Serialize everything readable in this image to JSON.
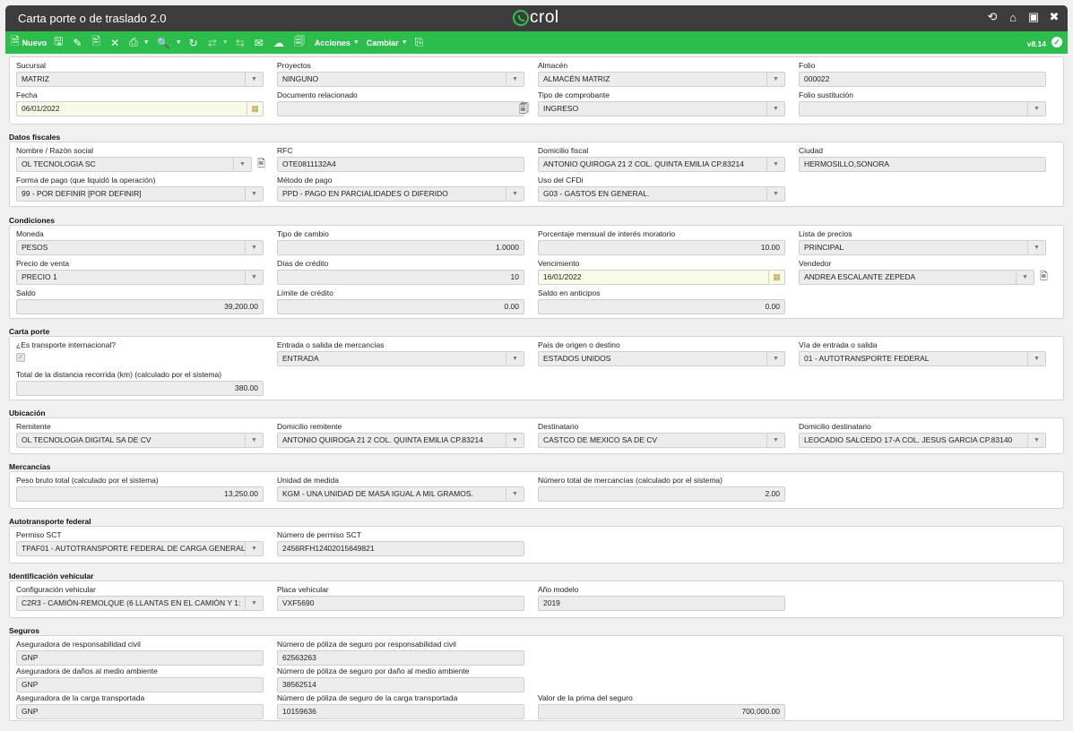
{
  "window": {
    "title": "Carta porte o de traslado 2.0",
    "logo": "crol"
  },
  "window_icons": [
    "refresh-icon",
    "home-icon",
    "window-icon",
    "close-icon"
  ],
  "toolbar": {
    "nuevo": "Nuevo",
    "acciones": "Acciones",
    "cambiar": "Cambiar",
    "version": "v8.14"
  },
  "general": {
    "sucursal": {
      "label": "Sucursal",
      "value": "MATRIZ"
    },
    "proyectos": {
      "label": "Proyectos",
      "value": "NINGUNO"
    },
    "almacen": {
      "label": "Almacén",
      "value": "ALMACÉN MATRIZ"
    },
    "folio": {
      "label": "Folio",
      "value": "000022"
    },
    "fecha": {
      "label": "Fecha",
      "value": "06/01/2022"
    },
    "documento": {
      "label": "Documento relacionado",
      "value": ""
    },
    "tipo": {
      "label": "Tipo de comprobante",
      "value": "INGRESO"
    },
    "folio_sust": {
      "label": "Folio sustitución",
      "value": ""
    }
  },
  "fiscales": {
    "title": "Datos fiscales",
    "nombre": {
      "label": "Nombre / Razón social",
      "value": "OL TECNOLOGIA SC"
    },
    "rfc": {
      "label": "RFC",
      "value": "OTE0811132A4"
    },
    "domicilio": {
      "label": "Domicilio fiscal",
      "value": "ANTONIO QUIROGA 21 2 COL. QUINTA EMILIA CP.83214"
    },
    "ciudad": {
      "label": "Ciudad",
      "value": "HERMOSILLO,SONORA"
    },
    "forma_pago": {
      "label": "Forma de pago (que liquidó la operación)",
      "value": "99 - POR DEFINIR [POR DEFINIR]"
    },
    "metodo_pago": {
      "label": "Método de pago",
      "value": "PPD - PAGO EN PARCIALIDADES O DIFERIDO"
    },
    "uso_cfdi": {
      "label": "Uso del CFDi",
      "value": "G03 - GASTOS EN GENERAL."
    }
  },
  "condiciones": {
    "title": "Condiciones",
    "moneda": {
      "label": "Moneda",
      "value": "PESOS"
    },
    "tipo_cambio": {
      "label": "Tipo de cambio",
      "value": "1.0000"
    },
    "interes": {
      "label": "Porcentaje mensual de interés moratorio",
      "value": "10.00"
    },
    "lista_precios": {
      "label": "Lista de precios",
      "value": "PRINCIPAL"
    },
    "precio_venta": {
      "label": "Precio de venta",
      "value": "PRECIO 1"
    },
    "dias_credito": {
      "label": "Días de crédito",
      "value": "10"
    },
    "vencimiento": {
      "label": "Vencimiento",
      "value": "16/01/2022"
    },
    "vendedor": {
      "label": "Vendedor",
      "value": "ANDREA ESCALANTE ZEPEDA"
    },
    "saldo": {
      "label": "Saldo",
      "value": "39,200.00"
    },
    "limite": {
      "label": "Límite de crédito",
      "value": "0.00"
    },
    "anticipos": {
      "label": "Saldo en anticipos",
      "value": "0.00"
    }
  },
  "carta_porte": {
    "title": "Carta porte",
    "internacional": {
      "label": "¿Es transporte internacional?",
      "checked": true
    },
    "entrada_salida": {
      "label": "Entrada o salida de mercancías",
      "value": "ENTRADA"
    },
    "pais": {
      "label": "País de origen o destino",
      "value": "ESTADOS UNIDOS"
    },
    "via": {
      "label": "Vía de entrada o salida",
      "value": "01 - AUTOTRANSPORTE FEDERAL"
    },
    "distancia": {
      "label": "Total de la distancia recorrida (km) (calculado por el sistema)",
      "value": "380.00"
    }
  },
  "ubicacion": {
    "title": "Ubicación",
    "remitente": {
      "label": "Remitente",
      "value": "OL TECNOLOGIA DIGITAL SA DE CV"
    },
    "dom_remitente": {
      "label": "Domicilio remitente",
      "value": "ANTONIO QUIROGA 21 2 COL. QUINTA EMILIA CP.83214"
    },
    "destinatario": {
      "label": "Destinatario",
      "value": "CASTCO DE MEXICO SA DE CV"
    },
    "dom_destinatario": {
      "label": "Domicilio destinatario",
      "value": "LEOCADIO SALCEDO 17-A  COL. JESUS GARCIA CP.83140"
    }
  },
  "mercancias": {
    "title": "Mercancías",
    "peso": {
      "label": "Peso bruto total (calculado por el sistema)",
      "value": "13,250.00"
    },
    "unidad": {
      "label": "Unidad de medida",
      "value": "KGM - UNA UNIDAD DE MASA IGUAL A MIL GRAMOS."
    },
    "numero": {
      "label": "Número total de mercancías (calculado por el sistema)",
      "value": "2.00"
    }
  },
  "autotransporte": {
    "title": "Autotransporte federal",
    "permiso": {
      "label": "Permiso SCT",
      "value": "TPAF01 - AUTOTRANSPORTE FEDERAL DE CARGA GENERAL"
    },
    "num_permiso": {
      "label": "Número de permiso SCT",
      "value": "2456RFH12402015649821"
    }
  },
  "vehicular": {
    "title": "Identificación vehicular",
    "config": {
      "label": "Configuración vehicular",
      "value": "C2R3 - CAMIÓN-REMOLQUE (6 LLANTAS EN EL CAMIÓN Y 1:"
    },
    "placa": {
      "label": "Placa vehicular",
      "value": "VXF5690"
    },
    "anio": {
      "label": "Año modelo",
      "value": "2019"
    }
  },
  "seguros": {
    "title": "Seguros",
    "aseg_civil": {
      "label": "Aseguradora de responsabilidad civil",
      "value": "GNP"
    },
    "poliza_civil": {
      "label": "Número de póliza de seguro por responsabilidad civil",
      "value": "62563263"
    },
    "aseg_ambiente": {
      "label": "Aseguradora de daños al medio ambiente",
      "value": "GNP"
    },
    "poliza_ambiente": {
      "label": "Número de póliza de seguro por daño al medio ambiente",
      "value": "38562514"
    },
    "aseg_carga": {
      "label": "Aseguradora de la carga transportada",
      "value": "GNP"
    },
    "poliza_carga": {
      "label": "Número de póliza de seguro de la carga transportada",
      "value": "10159636"
    },
    "prima": {
      "label": "Valor de la prima del seguro",
      "value": "700,000.00"
    }
  }
}
